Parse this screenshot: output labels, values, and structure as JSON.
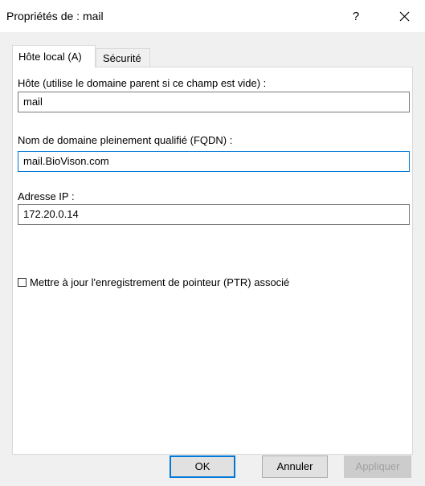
{
  "window": {
    "title": "Propriétés de : mail",
    "help_glyph": "?",
    "close_icon": "close-icon"
  },
  "tabs": [
    {
      "label": "Hôte local (A)",
      "active": true
    },
    {
      "label": "Sécurité",
      "active": false
    }
  ],
  "form": {
    "host_label": "Hôte (utilise le domaine parent si ce champ est vide) :",
    "host_value": "mail",
    "fqdn_label": "Nom de domaine pleinement qualifié (FQDN) :",
    "fqdn_value": "mail.BioVison.com",
    "ip_label": "Adresse IP :",
    "ip_value": "172.20.0.14",
    "ptr_checkbox_label": "Mettre à jour l'enregistrement de pointeur (PTR) associé",
    "ptr_checked": false
  },
  "buttons": {
    "ok": "OK",
    "cancel": "Annuler",
    "apply": "Appliquer"
  },
  "colors": {
    "accent": "#0078d7",
    "dialog_background": "#f0f0f0",
    "disabled_text": "#a0a0a0"
  }
}
